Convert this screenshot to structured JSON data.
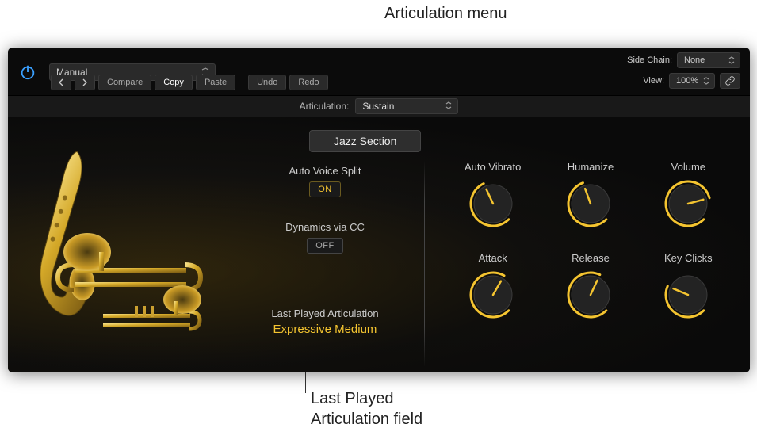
{
  "callouts": {
    "top": "Articulation menu",
    "bottom_line1": "Last Played",
    "bottom_line2": "Articulation field"
  },
  "toolbar": {
    "preset": "Manual",
    "compare": "Compare",
    "copy": "Copy",
    "paste": "Paste",
    "undo": "Undo",
    "redo": "Redo",
    "sidechain_label": "Side Chain:",
    "sidechain_value": "None",
    "view_label": "View:",
    "view_value": "100%"
  },
  "articulation": {
    "label": "Articulation:",
    "value": "Sustain"
  },
  "section": {
    "name": "Jazz Section"
  },
  "controls": {
    "auto_voice_split": {
      "label": "Auto Voice Split",
      "value": "ON",
      "on": true
    },
    "dynamics_cc": {
      "label": "Dynamics via CC",
      "value": "OFF",
      "on": false
    },
    "last_played": {
      "label": "Last Played Articulation",
      "value": "Expressive Medium"
    }
  },
  "knobs": {
    "auto_vibrato": {
      "label": "Auto Vibrato",
      "angle": 200
    },
    "humanize": {
      "label": "Humanize",
      "angle": 205
    },
    "volume": {
      "label": "Volume",
      "angle": 300
    },
    "attack": {
      "label": "Attack",
      "angle": 255
    },
    "release": {
      "label": "Release",
      "angle": 250
    },
    "key_clicks": {
      "label": "Key Clicks",
      "angle": 158
    }
  },
  "colors": {
    "accent": "#f4c430"
  }
}
